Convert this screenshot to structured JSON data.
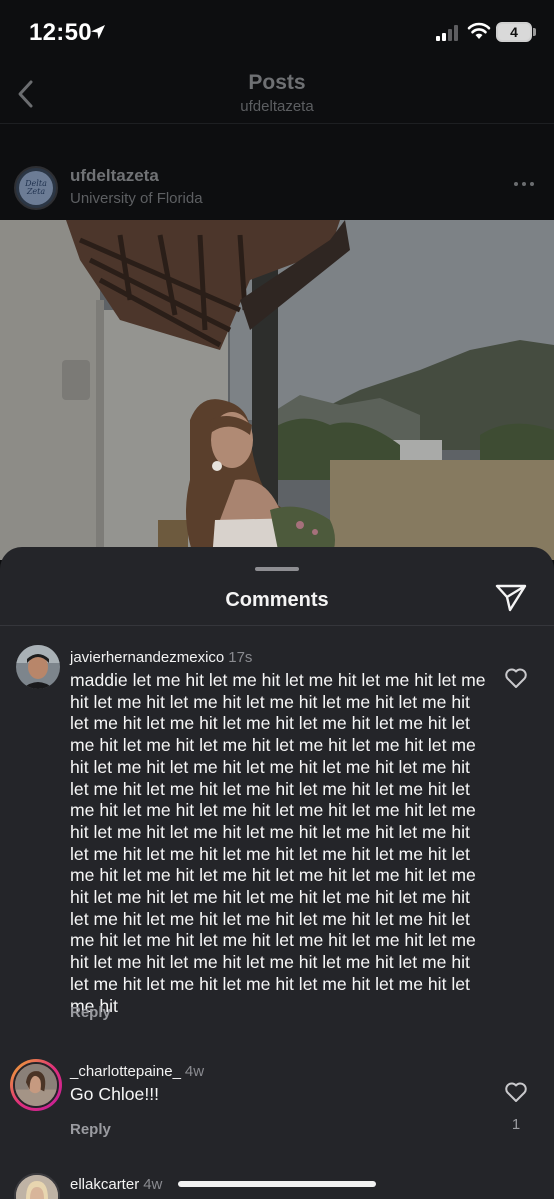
{
  "status_bar": {
    "time": "12:50",
    "battery": "4"
  },
  "header": {
    "title": "Posts",
    "subtitle": "ufdeltazeta"
  },
  "post": {
    "avatar_text": "Delta Zeta",
    "username": "ufdeltazeta",
    "location": "University of Florida"
  },
  "comments_sheet": {
    "title": "Comments",
    "comments": [
      {
        "username": "javierhernandezmexico",
        "time": "17s",
        "text": "maddie let me hit let me hit let me hit let me hit let me hit let me hit let me hit let me hit let me hit let me hit let me hit let me hit let me hit let me hit let me hit let me hit let me hit let me hit let me hit let me hit let me hit let me hit let me hit let me hit let me hit let me hit let me hit let me hit let me hit let me hit let me hit let me hit let me hit let me hit let me hit let me hit let me hit let me hit let me hit let me hit let me hit let me hit let me hit let me hit let me hit let me hit let me hit let me hit let me hit let me hit let me hit let me hit let me hit let me hit let me hit let me hit let me hit let me hit let me hit let me hit let me hit let me hit let me hit let me hit let me hit let me hit let me hit let me hit let me hit let me hit let me hit let me hit let me hit let me hit let me hit let me hit let me hit let me hit let me hit let me hit",
        "reply_label": "Reply"
      },
      {
        "username": "_charlottepaine_",
        "time": "4w",
        "text": "Go Chloe!!!",
        "reply_label": "Reply",
        "likes": "1"
      },
      {
        "username": "ellakcarter",
        "time": "4w"
      }
    ]
  }
}
